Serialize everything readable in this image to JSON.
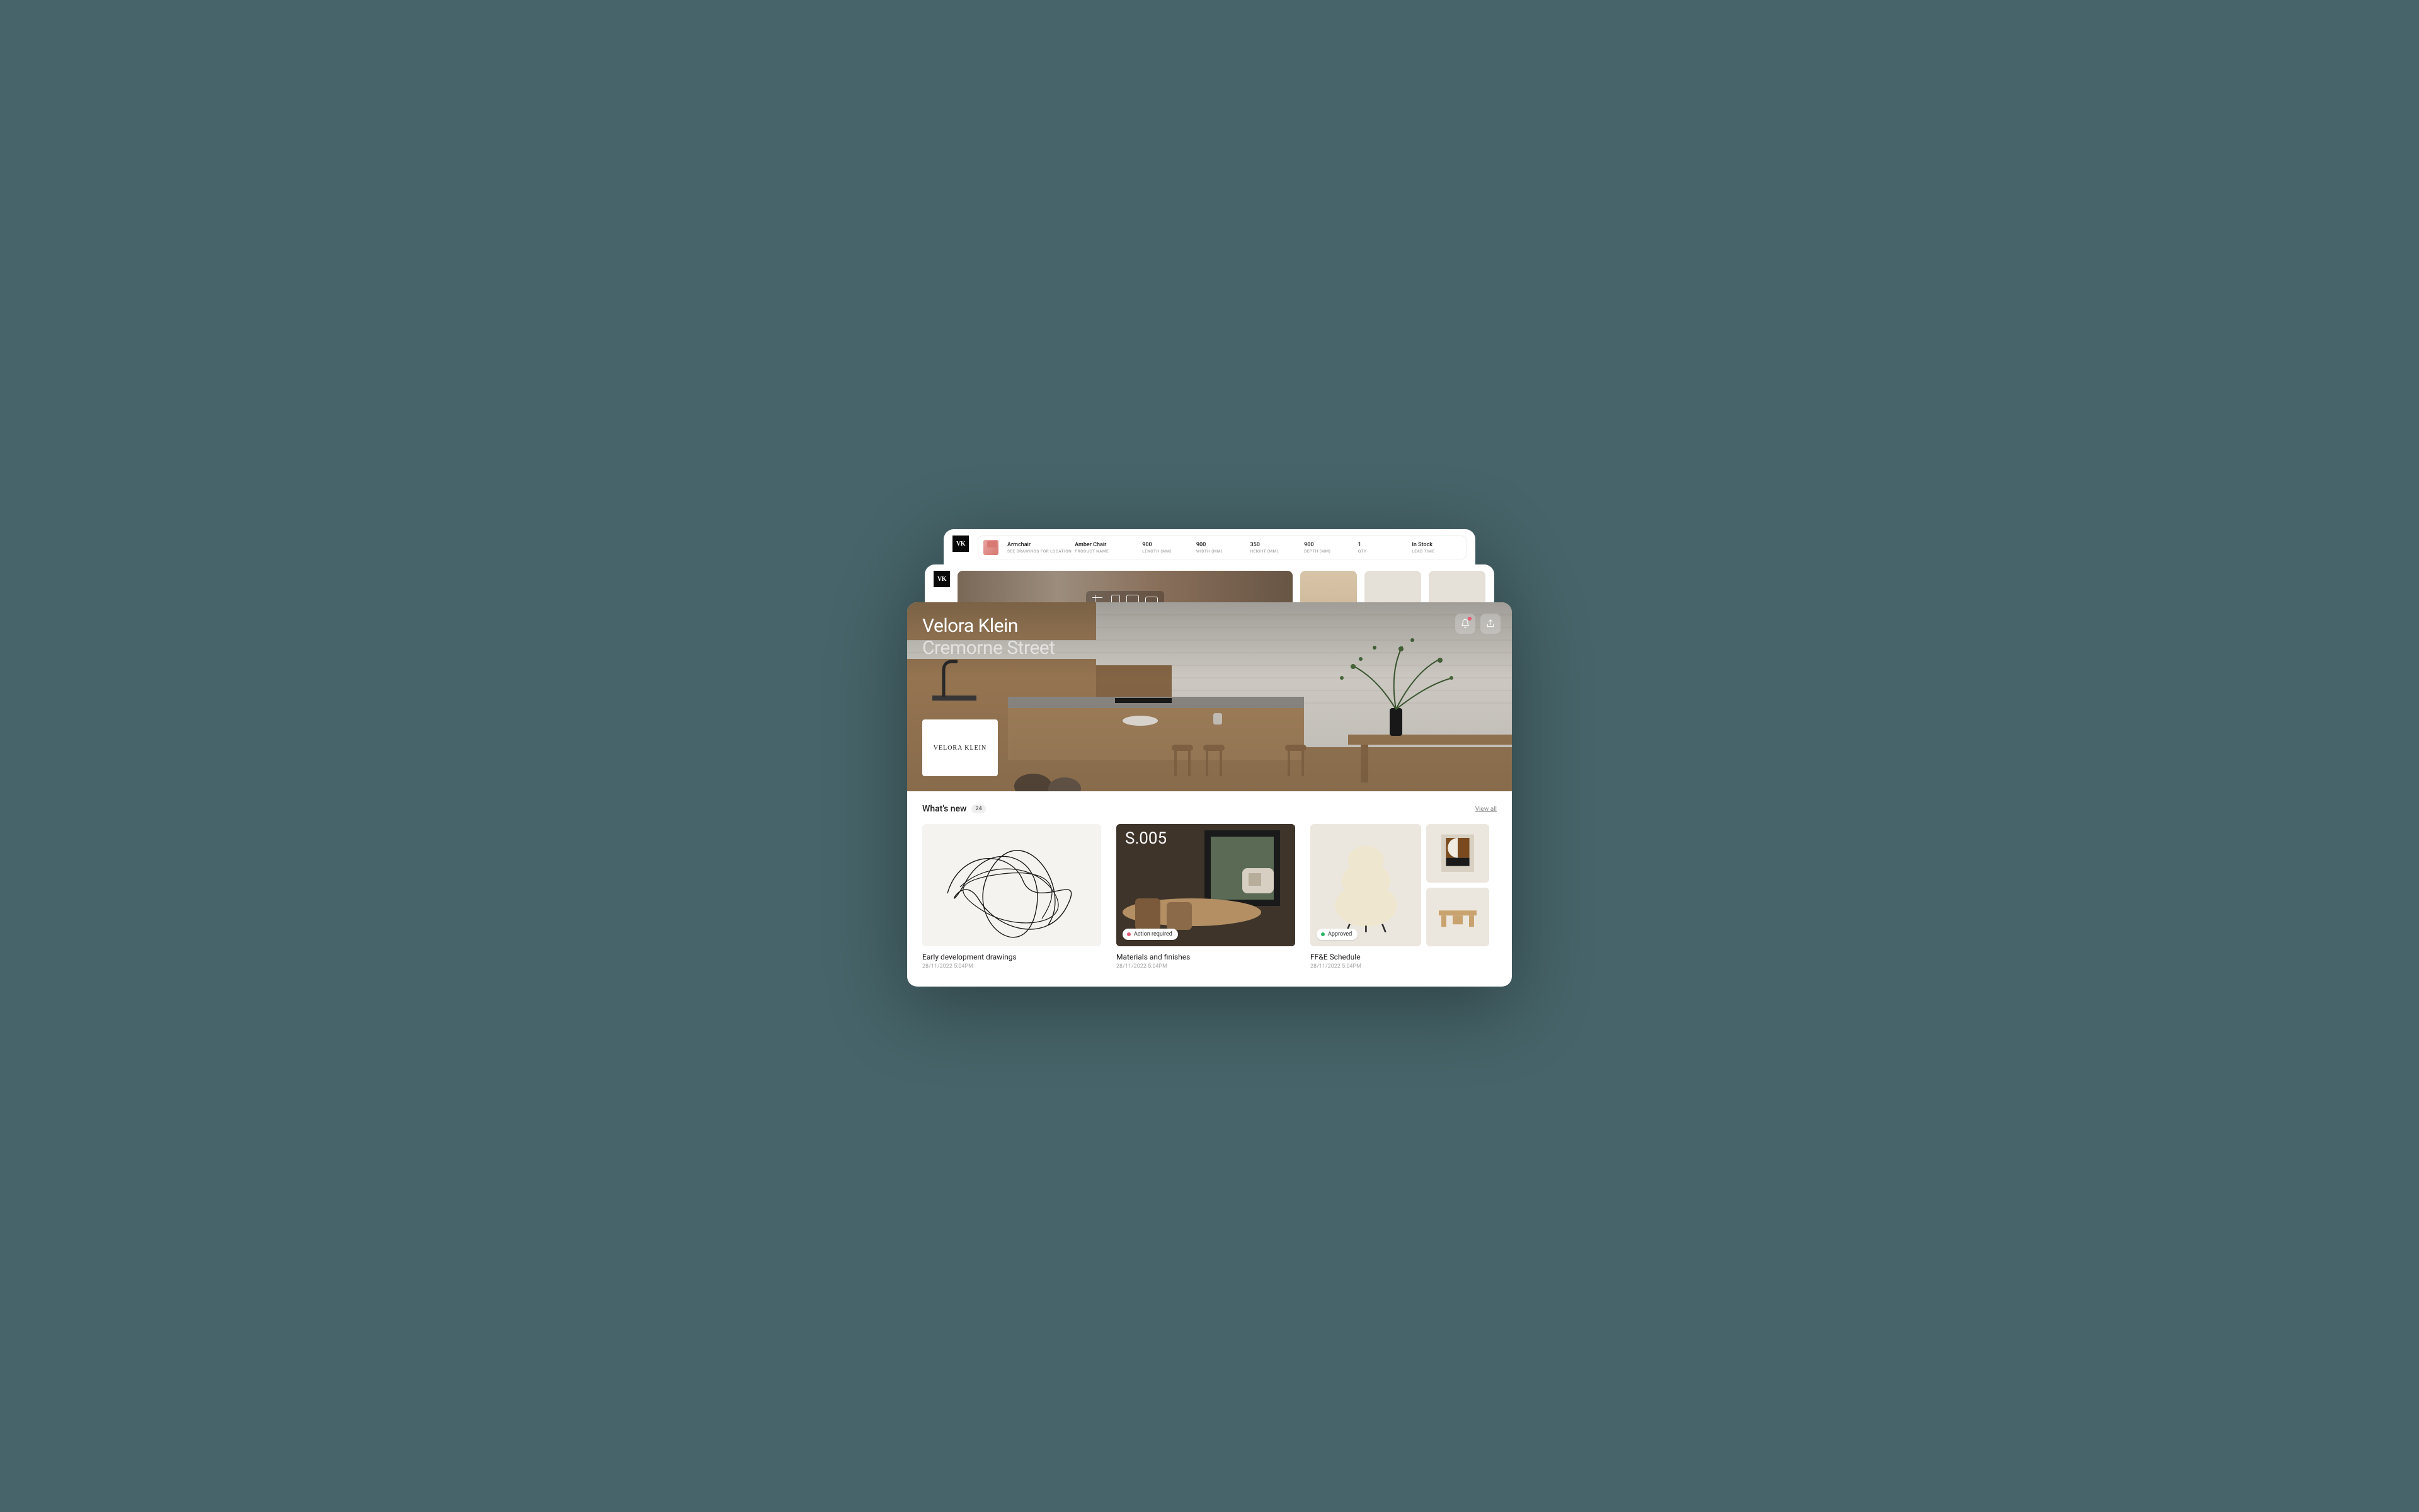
{
  "brand_monogram": "VK",
  "spec": {
    "cells": [
      {
        "value": "Armchair",
        "label": "SEE DRAWINGS FOR LOCATION"
      },
      {
        "value": "Amber Chair",
        "label": "PRODUCT NAME"
      },
      {
        "value": "900",
        "label": "LENGTH (MM)"
      },
      {
        "value": "900",
        "label": "WIDTH (MM)"
      },
      {
        "value": "350",
        "label": "HEIGHT (MM)"
      },
      {
        "value": "900",
        "label": "DEPTH (MM)"
      },
      {
        "value": "1",
        "label": "QTY"
      },
      {
        "value": "In Stock",
        "label": "LEAD TIME"
      }
    ]
  },
  "hero": {
    "studio": "Velora Klein",
    "project": "Cremorne Street",
    "brand_card": "VELORA KLEIN"
  },
  "whats_new": {
    "title": "What's new",
    "count": "24",
    "view_all": "View all",
    "cards": [
      {
        "title": "Early development drawings",
        "timestamp": "28/11/2022 5:04PM"
      },
      {
        "overlay_code": "S.005",
        "status_label": "Action required",
        "status_color": "red",
        "title": "Materials and finishes",
        "timestamp": "28/11/2022 5:04PM"
      },
      {
        "status_label": "Approved",
        "status_color": "green",
        "title": "FF&E Schedule",
        "timestamp": "28/11/2022 5:04PM"
      }
    ]
  }
}
